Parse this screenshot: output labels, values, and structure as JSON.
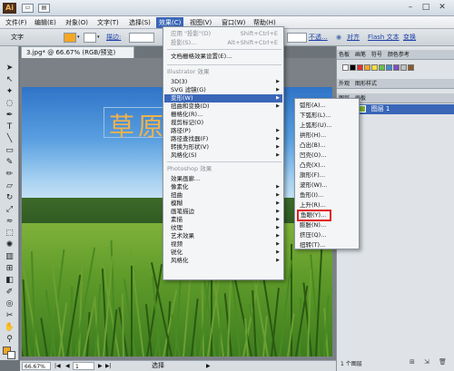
{
  "titlebar": {
    "app_logo": "Ai",
    "icons": [
      "document-icon",
      "arrange-icon"
    ]
  },
  "menubar": {
    "items": [
      {
        "label": "文件(F)"
      },
      {
        "label": "编辑(E)"
      },
      {
        "label": "对象(O)"
      },
      {
        "label": "文字(T)"
      },
      {
        "label": "选择(S)"
      },
      {
        "label": "效果(C)"
      },
      {
        "label": "视图(V)"
      },
      {
        "label": "窗口(W)"
      },
      {
        "label": "帮助(H)"
      }
    ]
  },
  "controlbar": {
    "tool_label": "文字",
    "stroke_label": "描边:",
    "opacity_label": "不透...",
    "align_label": "对齐",
    "flash_text_label": "Flash 文本",
    "transform_label": "变换"
  },
  "document": {
    "tab_title": "3.jpg* @ 66.67% (RGB/预览)",
    "art_text": "草原"
  },
  "statusbar": {
    "zoom": "66.67%",
    "page": "1",
    "tool": "选择"
  },
  "panel_right": {
    "tabs_top": [
      "色板",
      "画笔",
      "符号",
      "颜色参考"
    ],
    "tabs_mid": [
      "外观",
      "图形样式"
    ],
    "tabs_layers": [
      "图层",
      "画板"
    ],
    "layer_name": "图层 1",
    "layer_count": "1 个图层",
    "swatch_colors": [
      "#ffffff",
      "#000000",
      "#e03131",
      "#f5a623",
      "#f7e03c",
      "#6abf4b",
      "#3a8fd6",
      "#7b4fc2",
      "#c0c0c0",
      "#8b5a2b"
    ]
  },
  "effect_menu": {
    "items": [
      {
        "label": "应用 \"投影\"(D)",
        "shortcut": "Shift+Ctrl+E",
        "disabled": true
      },
      {
        "label": "投影(S)...",
        "shortcut": "Alt+Shift+Ctrl+E",
        "disabled": true
      },
      {
        "label": "文档栅格效果设置(E)..."
      },
      {
        "label": "Illustrator 效果",
        "header": true
      },
      {
        "label": "3D(3)",
        "submenu": true
      },
      {
        "label": "SVG 滤镜(G)",
        "submenu": true
      },
      {
        "label": "变形(W)",
        "submenu": true,
        "highlighted": true
      },
      {
        "label": "扭曲和变换(D)",
        "submenu": true
      },
      {
        "label": "栅格化(R)..."
      },
      {
        "label": "裁剪标记(O)"
      },
      {
        "label": "路径(P)",
        "submenu": true
      },
      {
        "label": "路径查找器(F)",
        "submenu": true
      },
      {
        "label": "转换为形状(V)",
        "submenu": true
      },
      {
        "label": "风格化(S)",
        "submenu": true
      },
      {
        "label": "Photoshop 效果",
        "header": true
      },
      {
        "label": "效果画廊..."
      },
      {
        "label": "像素化",
        "submenu": true
      },
      {
        "label": "扭曲",
        "submenu": true
      },
      {
        "label": "模糊",
        "submenu": true
      },
      {
        "label": "画笔描边",
        "submenu": true
      },
      {
        "label": "素描",
        "submenu": true
      },
      {
        "label": "纹理",
        "submenu": true
      },
      {
        "label": "艺术效果",
        "submenu": true
      },
      {
        "label": "视频",
        "submenu": true
      },
      {
        "label": "锐化",
        "submenu": true
      },
      {
        "label": "风格化",
        "submenu": true
      }
    ]
  },
  "warp_submenu": {
    "items": [
      {
        "label": "弧形(A)..."
      },
      {
        "label": "下弧形(L)..."
      },
      {
        "label": "上弧形(U)..."
      },
      {
        "label": "拱形(H)..."
      },
      {
        "label": "凸出(B)..."
      },
      {
        "label": "凹壳(O)..."
      },
      {
        "label": "凸壳(X)..."
      },
      {
        "label": "旗形(F)..."
      },
      {
        "label": "波形(W)..."
      },
      {
        "label": "鱼形(I)..."
      },
      {
        "label": "上升(R)..."
      },
      {
        "label": "鱼眼(Y)...",
        "selected_box": true
      },
      {
        "label": "膨胀(N)..."
      },
      {
        "label": "挤压(Q)..."
      },
      {
        "label": "扭转(T)..."
      }
    ]
  }
}
